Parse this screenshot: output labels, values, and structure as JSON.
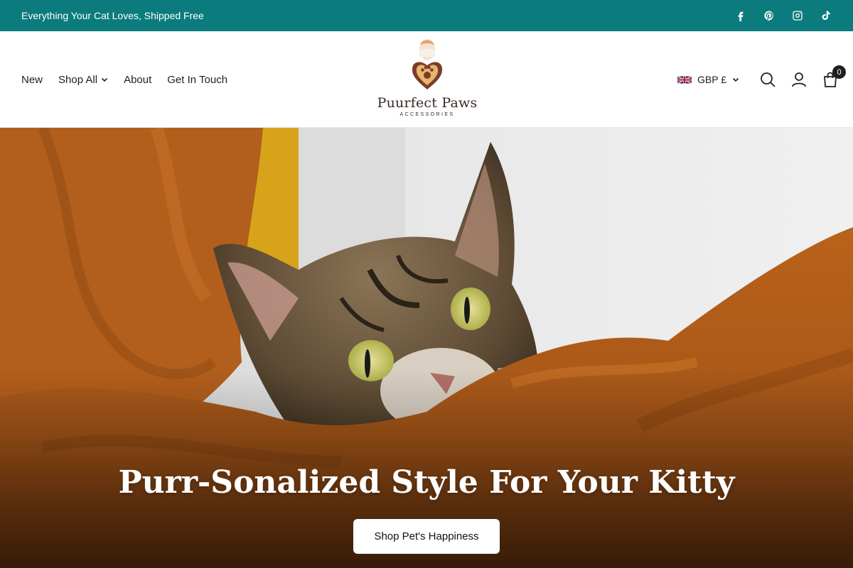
{
  "announcement": {
    "text": "Everything Your Cat Loves, Shipped Free",
    "background": "#0c7b7d",
    "social_icons": [
      "facebook-icon",
      "pinterest-icon",
      "instagram-icon",
      "tiktok-icon"
    ]
  },
  "nav": {
    "items": [
      {
        "label": "New"
      },
      {
        "label": "Shop All",
        "has_dropdown": true
      },
      {
        "label": "About"
      },
      {
        "label": "Get In Touch"
      }
    ]
  },
  "logo": {
    "name": "Puurfect Paws",
    "tagline": "ACCESSORIES"
  },
  "header_tools": {
    "currency": "GBP £",
    "currency_flag": "uk-flag-icon",
    "icons": [
      "search-icon",
      "account-icon",
      "cart-icon"
    ],
    "cart_count": "0"
  },
  "hero": {
    "title": "Purr-Sonalized Style For Your Kitty",
    "button_label": "Shop Pet's Happiness"
  }
}
